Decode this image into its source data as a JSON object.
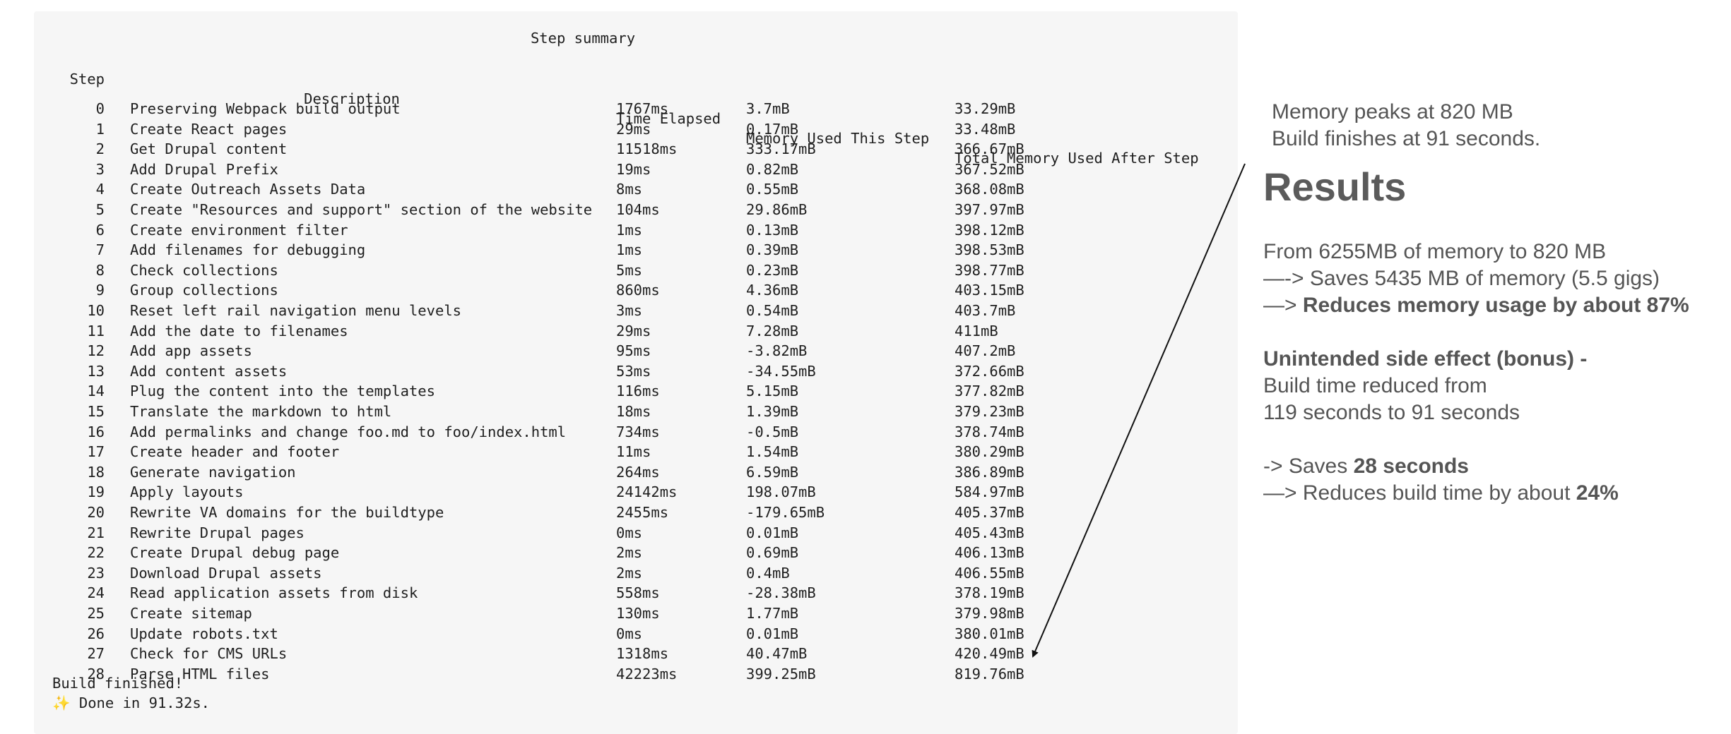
{
  "terminal": {
    "title": "Step summary",
    "headers": {
      "step": "Step",
      "description": "Description",
      "time": "Time Elapsed",
      "memory": "Memory Used This Step",
      "total": "Total Memory Used After Step"
    },
    "rows": [
      {
        "step": "0",
        "desc": "Preserving Webpack build output",
        "time": "1767ms",
        "mem": "3.7mB",
        "total": "33.29mB"
      },
      {
        "step": "1",
        "desc": "Create React pages",
        "time": "29ms",
        "mem": "0.17mB",
        "total": "33.48mB"
      },
      {
        "step": "2",
        "desc": "Get Drupal content",
        "time": "11518ms",
        "mem": "333.17mB",
        "total": "366.67mB"
      },
      {
        "step": "3",
        "desc": "Add Drupal Prefix",
        "time": "19ms",
        "mem": "0.82mB",
        "total": "367.52mB"
      },
      {
        "step": "4",
        "desc": "Create Outreach Assets Data",
        "time": "8ms",
        "mem": "0.55mB",
        "total": "368.08mB"
      },
      {
        "step": "5",
        "desc": "Create \"Resources and support\" section of the website",
        "time": "104ms",
        "mem": "29.86mB",
        "total": "397.97mB"
      },
      {
        "step": "6",
        "desc": "Create environment filter",
        "time": "1ms",
        "mem": "0.13mB",
        "total": "398.12mB"
      },
      {
        "step": "7",
        "desc": "Add filenames for debugging",
        "time": "1ms",
        "mem": "0.39mB",
        "total": "398.53mB"
      },
      {
        "step": "8",
        "desc": "Check collections",
        "time": "5ms",
        "mem": "0.23mB",
        "total": "398.77mB"
      },
      {
        "step": "9",
        "desc": "Group collections",
        "time": "860ms",
        "mem": "4.36mB",
        "total": "403.15mB"
      },
      {
        "step": "10",
        "desc": "Reset left rail navigation menu levels",
        "time": "3ms",
        "mem": "0.54mB",
        "total": "403.7mB"
      },
      {
        "step": "11",
        "desc": "Add the date to filenames",
        "time": "29ms",
        "mem": "7.28mB",
        "total": "411mB"
      },
      {
        "step": "12",
        "desc": "Add app assets",
        "time": "95ms",
        "mem": "-3.82mB",
        "total": "407.2mB"
      },
      {
        "step": "13",
        "desc": "Add content assets",
        "time": "53ms",
        "mem": "-34.55mB",
        "total": "372.66mB"
      },
      {
        "step": "14",
        "desc": "Plug the content into the templates",
        "time": "116ms",
        "mem": "5.15mB",
        "total": "377.82mB"
      },
      {
        "step": "15",
        "desc": "Translate the markdown to html",
        "time": "18ms",
        "mem": "1.39mB",
        "total": "379.23mB"
      },
      {
        "step": "16",
        "desc": "Add permalinks and change foo.md to foo/index.html",
        "time": "734ms",
        "mem": "-0.5mB",
        "total": "378.74mB"
      },
      {
        "step": "17",
        "desc": "Create header and footer",
        "time": "11ms",
        "mem": "1.54mB",
        "total": "380.29mB"
      },
      {
        "step": "18",
        "desc": "Generate navigation",
        "time": "264ms",
        "mem": "6.59mB",
        "total": "386.89mB"
      },
      {
        "step": "19",
        "desc": "Apply layouts",
        "time": "24142ms",
        "mem": "198.07mB",
        "total": "584.97mB"
      },
      {
        "step": "20",
        "desc": "Rewrite VA domains for the buildtype",
        "time": "2455ms",
        "mem": "-179.65mB",
        "total": "405.37mB"
      },
      {
        "step": "21",
        "desc": "Rewrite Drupal pages",
        "time": "0ms",
        "mem": "0.01mB",
        "total": "405.43mB"
      },
      {
        "step": "22",
        "desc": "Create Drupal debug page",
        "time": "2ms",
        "mem": "0.69mB",
        "total": "406.13mB"
      },
      {
        "step": "23",
        "desc": "Download Drupal assets",
        "time": "2ms",
        "mem": "0.4mB",
        "total": "406.55mB"
      },
      {
        "step": "24",
        "desc": "Read application assets from disk",
        "time": "558ms",
        "mem": "-28.38mB",
        "total": "378.19mB"
      },
      {
        "step": "25",
        "desc": "Create sitemap",
        "time": "130ms",
        "mem": "1.77mB",
        "total": "379.98mB"
      },
      {
        "step": "26",
        "desc": "Update robots.txt",
        "time": "0ms",
        "mem": "0.01mB",
        "total": "380.01mB"
      },
      {
        "step": "27",
        "desc": "Check for CMS URLs",
        "time": "1318ms",
        "mem": "40.47mB",
        "total": "420.49mB"
      },
      {
        "step": "28",
        "desc": "Parse HTML files",
        "time": "42223ms",
        "mem": "399.25mB",
        "total": "819.76mB"
      }
    ],
    "build_finished": "Build finished!",
    "sparkle_icon": "✨",
    "done": "Done in 91.32s."
  },
  "notes": {
    "peak_line1": "Memory peaks at 820 MB",
    "peak_line2": "Build finishes at 91 seconds.",
    "results_title": "Results",
    "mem_line1": "From 6255MB of memory to 820 MB",
    "mem_line2": "—-> Saves 5435 MB of memory (5.5 gigs)",
    "mem_line3_prefix": "—> ",
    "mem_line3_bold": "Reduces memory usage by about 87%",
    "side_title": "Unintended side effect (bonus) -",
    "side_line1": "Build time reduced from",
    "side_line2": "119 seconds to 91 seconds",
    "saves_prefix": "-> Saves ",
    "saves_bold": "28 seconds",
    "reduce_prefix": "—> Reduces build time by about ",
    "reduce_bold": "24%"
  }
}
